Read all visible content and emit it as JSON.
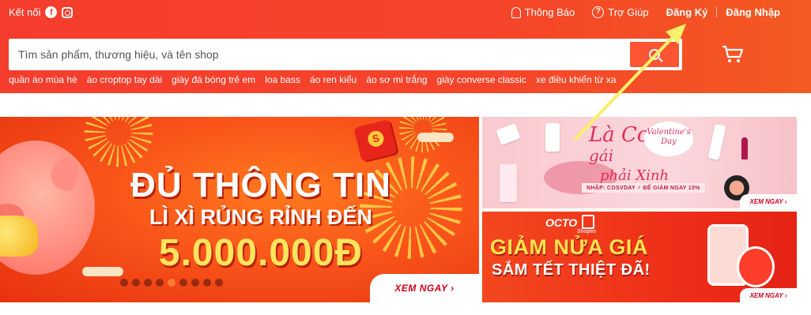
{
  "topbar": {
    "connect_label": "Kết nối",
    "facebook_glyph": "f",
    "notifications_label": "Thông Báo",
    "help_label": "Trợ Giúp",
    "help_glyph": "?",
    "register_label": "Đăng Ký",
    "login_label": "Đăng Nhập"
  },
  "search": {
    "placeholder": "Tìm sản phẩm, thương hiệu, và tên shop",
    "value": ""
  },
  "keywords": [
    "quần áo mùa hè",
    "áo croptop tay dài",
    "giày đá bóng trẻ em",
    "loa bass",
    "áo ren kiểu",
    "áo sơ mi trắng",
    "giày converse classic",
    "xe điều khiển từ xa"
  ],
  "banner_main": {
    "line1": "ĐỦ THÔNG TIN",
    "line2": "LÌ XÌ RỦNG RỈNH ĐẾN",
    "line3": "5.000.000Đ",
    "cta": "XEM NGAY ›",
    "slide_count": 9,
    "active_slide": 4
  },
  "banner_valentine": {
    "title_line1": "Là Con",
    "title_line2": "gái",
    "title_line3": "phải Xinh",
    "badge": "Valentine's Day",
    "promo": "NHẬP: COSVDAY ⚡ ĐỂ GIẢM NGAY 10%",
    "cta": "XEM NGAY ›"
  },
  "banner_octo": {
    "logo": "OCTO",
    "shop_label": "Shopee",
    "line1": "GIẢM NỬA GIÁ",
    "line2": "SẮM TẾT THIỆT ĐÃ!",
    "cta": "XEM NGAY ›"
  },
  "colors": {
    "header": "#f53d2d",
    "search_button": "#fb5533",
    "cta_text": "#d0011b",
    "annotation_arrow": "#f7f06a"
  }
}
